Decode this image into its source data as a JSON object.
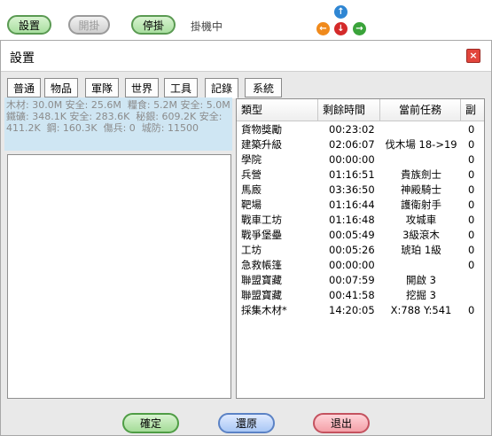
{
  "topbar": {
    "settings_label": "設置",
    "start_label": "開掛",
    "stop_label": "停掛",
    "status_text": "掛機中"
  },
  "arrows": {
    "up": "↑",
    "left": "←",
    "down": "↓",
    "right": "→"
  },
  "dialog": {
    "title": "設置",
    "close_symbol": "×",
    "tabs": [
      "普通",
      "物品",
      "軍隊",
      "世界",
      "工具",
      "記錄",
      "系統"
    ],
    "active_tab": "記錄",
    "resource_stats": "木材: 30.0M 安全: 25.6M  糧食: 5.2M 安全: 5.0M\n鐵礦: 348.1K 安全: 283.6K  秘銀: 609.2K 安全:\n411.2K  鋼: 160.3K  傷兵: 0  城防: 11500",
    "table": {
      "headers": [
        "類型",
        "剩餘時間",
        "當前任務",
        "副"
      ],
      "rows": [
        [
          "貨物獎勵",
          "00:23:02",
          "",
          "0"
        ],
        [
          "建築升級",
          "02:06:07",
          "伐木場 18->19",
          "0"
        ],
        [
          "學院",
          "00:00:00",
          "",
          "0"
        ],
        [
          "兵營",
          "01:16:51",
          "貴族劍士",
          "0"
        ],
        [
          "馬廄",
          "03:36:50",
          "神殿騎士",
          "0"
        ],
        [
          "靶場",
          "01:16:44",
          "護衛射手",
          "0"
        ],
        [
          "戰車工坊",
          "01:16:48",
          "攻城車",
          "0"
        ],
        [
          "戰爭堡壘",
          "00:05:49",
          "3級滾木",
          "0"
        ],
        [
          "工坊",
          "00:05:26",
          "琥珀 1級",
          "0"
        ],
        [
          "急救帳篷",
          "00:00:00",
          "",
          "0"
        ],
        [
          "聯盟寶藏",
          "00:07:59",
          "開啟 3",
          ""
        ],
        [
          "聯盟寶藏",
          "00:41:58",
          "挖掘 3",
          ""
        ],
        [
          "採集木材*",
          "14:20:05",
          "X:788 Y:541",
          "0"
        ]
      ]
    },
    "buttons": {
      "ok_label": "確定",
      "reset_label": "還原",
      "exit_label": "退出"
    }
  }
}
